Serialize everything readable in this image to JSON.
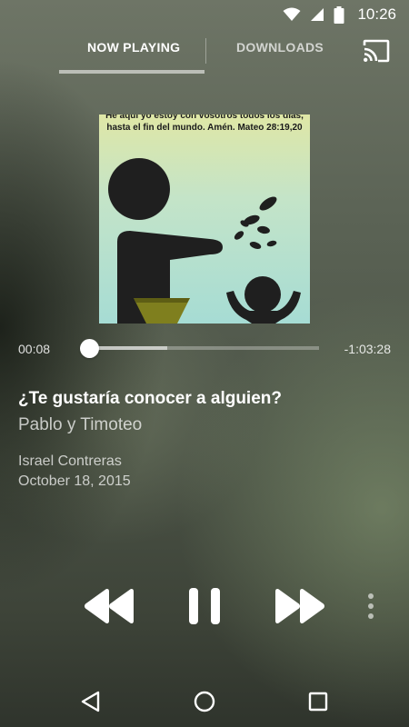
{
  "status_bar": {
    "time": "10:26",
    "icons": [
      "wifi-icon",
      "signal-icon",
      "battery-icon"
    ]
  },
  "tabs": {
    "now_playing": "NOW PLAYING",
    "downloads": "DOWNLOADS",
    "active": "now_playing"
  },
  "toolbar": {
    "cast_icon": "cast-icon"
  },
  "album_art": {
    "verse_line1": "He aquí yo estoy con vosotros todos los días,",
    "verse_line2": "hasta el fin del mundo. Amén. Mateo 28:19,20"
  },
  "player": {
    "elapsed": "00:08",
    "remaining": "-1:03:28",
    "progress": 0.002,
    "buffered": 0.34
  },
  "track": {
    "title": "¿Te gustaría conocer a alguien?",
    "series": "Pablo y Timoteo",
    "speaker": "Israel Contreras",
    "date": "October 18, 2015"
  },
  "controls": {
    "rewind": "rewind-icon",
    "pause": "pause-icon",
    "forward": "fast-forward-icon",
    "more": "more-vert-icon"
  },
  "nav_bar": {
    "back": "back-icon",
    "home": "home-icon",
    "recents": "recents-icon"
  },
  "colors": {
    "accent": "#ffffff",
    "background": "#5b6355",
    "art_bowl": "#7f7f1e",
    "art_figure": "#1f1f1f"
  }
}
